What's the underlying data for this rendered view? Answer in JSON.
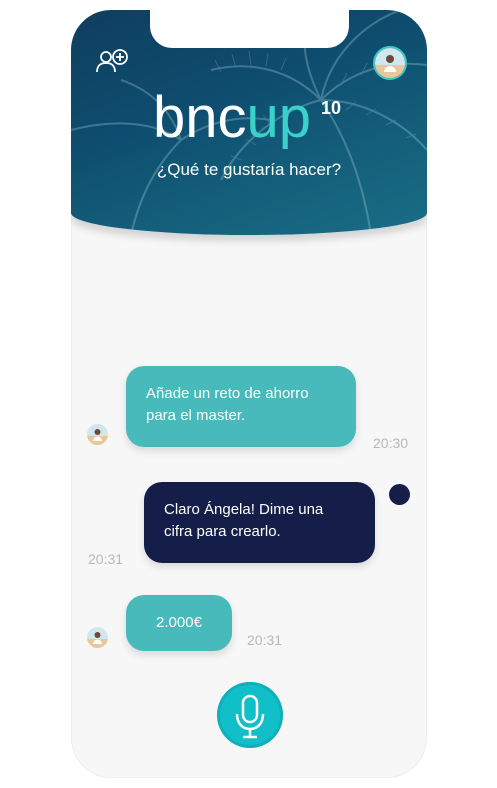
{
  "app": {
    "logo_main": "bnc",
    "logo_accent": "up",
    "logo_superscript": "10",
    "prompt": "¿Qué te gustaría hacer?"
  },
  "header": {
    "add_user_icon": "add-user-icon",
    "profile_avatar": "profile-avatar"
  },
  "chat": {
    "messages": [
      {
        "sender": "user",
        "text_line1": "Añade un reto de ahorro",
        "text_line2": "para el master.",
        "time": "20:30"
      },
      {
        "sender": "bot",
        "text_line1": "Claro Ángela! Dime una",
        "text_line2": "cifra para crearlo.",
        "time": "20:31"
      },
      {
        "sender": "user",
        "text_line1": "2.000€",
        "time": "20:31"
      }
    ]
  },
  "colors": {
    "accent": "#39d1c9",
    "user_bubble": "#48babb",
    "bot_bubble": "#141e49",
    "header": "#0e4d6f",
    "mic": "#11bfc9"
  },
  "mic": {
    "icon": "microphone-icon"
  }
}
